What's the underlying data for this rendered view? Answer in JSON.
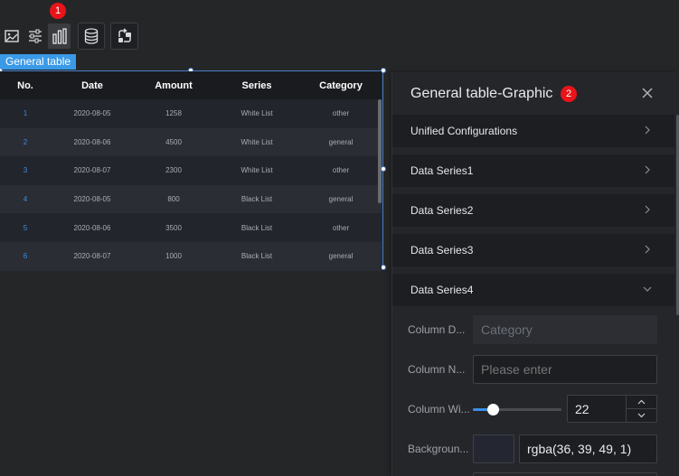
{
  "toolbar": {
    "items": [
      {
        "icon": "image-icon"
      },
      {
        "icon": "sliders-icon"
      },
      {
        "icon": "bar-chart-icon",
        "active": true
      },
      {
        "icon": "database-icon"
      },
      {
        "icon": "link-icon"
      }
    ],
    "badge": "1"
  },
  "component_label": "General table",
  "table": {
    "columns": [
      "No.",
      "Date",
      "Amount",
      "Series",
      "Category"
    ],
    "rows": [
      [
        "1",
        "2020-08-05",
        "1258",
        "White List",
        "other"
      ],
      [
        "2",
        "2020-08-06",
        "4500",
        "White List",
        "general"
      ],
      [
        "3",
        "2020-08-07",
        "2300",
        "White List",
        "other"
      ],
      [
        "4",
        "2020-08-05",
        "800",
        "Black List",
        "general"
      ],
      [
        "5",
        "2020-08-06",
        "3500",
        "Black List",
        "other"
      ],
      [
        "6",
        "2020-08-07",
        "1000",
        "Black List",
        "general"
      ]
    ]
  },
  "panel": {
    "title": "General table-Graphic",
    "badge": "2",
    "sections": [
      "Unified Configurations",
      "Data Series1",
      "Data Series2",
      "Data Series3",
      "Data Series4"
    ],
    "fields": {
      "column_data_label": "Column D...",
      "column_data_value": "Category",
      "column_name_label": "Column N...",
      "column_name_placeholder": "Please enter",
      "column_width_label": "Column Wi...",
      "column_width_value": "22",
      "column_width_slider_fraction": 0.22,
      "background_label": "Backgroun...",
      "background_value": "rgba(36, 39, 49, 1)"
    }
  },
  "colors": {
    "accent": "#3a8ee6",
    "badge": "#e8141a",
    "label_bg": "#3a9ae8",
    "background_swatch": "#242731"
  }
}
